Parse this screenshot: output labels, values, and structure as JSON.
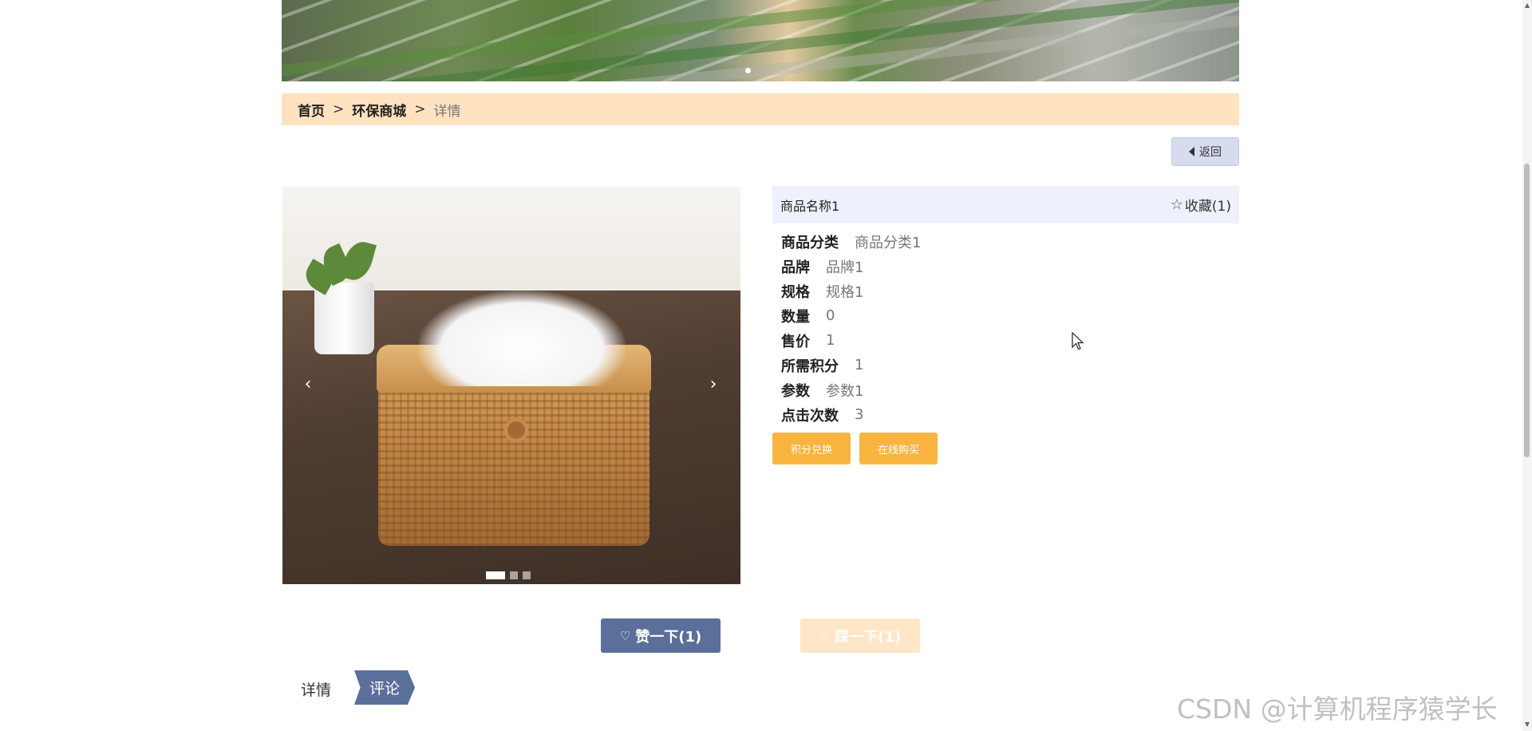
{
  "breadcrumb": {
    "home": "首页",
    "sep": ">",
    "mall": "环保商城",
    "current": "详情"
  },
  "back_button": {
    "label": "返回",
    "icon": "caret-left-icon"
  },
  "product": {
    "name": "商品名称1",
    "favorite_label": "收藏(1)",
    "favorite_icon": "star-outline-icon",
    "fields": [
      {
        "label": "商品分类",
        "value": "商品分类1"
      },
      {
        "label": "品牌",
        "value": "品牌1"
      },
      {
        "label": "规格",
        "value": "规格1"
      },
      {
        "label": "数量",
        "value": "0"
      },
      {
        "label": "售价",
        "value": "1"
      },
      {
        "label": "所需积分",
        "value": "1"
      },
      {
        "label": "参数",
        "value": "参数1"
      },
      {
        "label": "点击次数",
        "value": "3"
      }
    ],
    "exchange_label": "积分兑换",
    "buy_label": "在线购买"
  },
  "carousel": {
    "prev": "‹",
    "next": "›",
    "slides": 3,
    "active_slide": 1
  },
  "reactions": {
    "like_label": "赞一下(1)",
    "dislike_label": "踩一下(1)"
  },
  "tabs": {
    "detail": "详情",
    "comment": "评论",
    "active": "评论"
  },
  "watermark": "CSDN @计算机程序猿学长",
  "colors": {
    "accent": "#5a6f99",
    "orange": "#f9b440",
    "breadcrumb_bg": "#ffe3c0",
    "info_header_bg": "#eef1fb"
  }
}
